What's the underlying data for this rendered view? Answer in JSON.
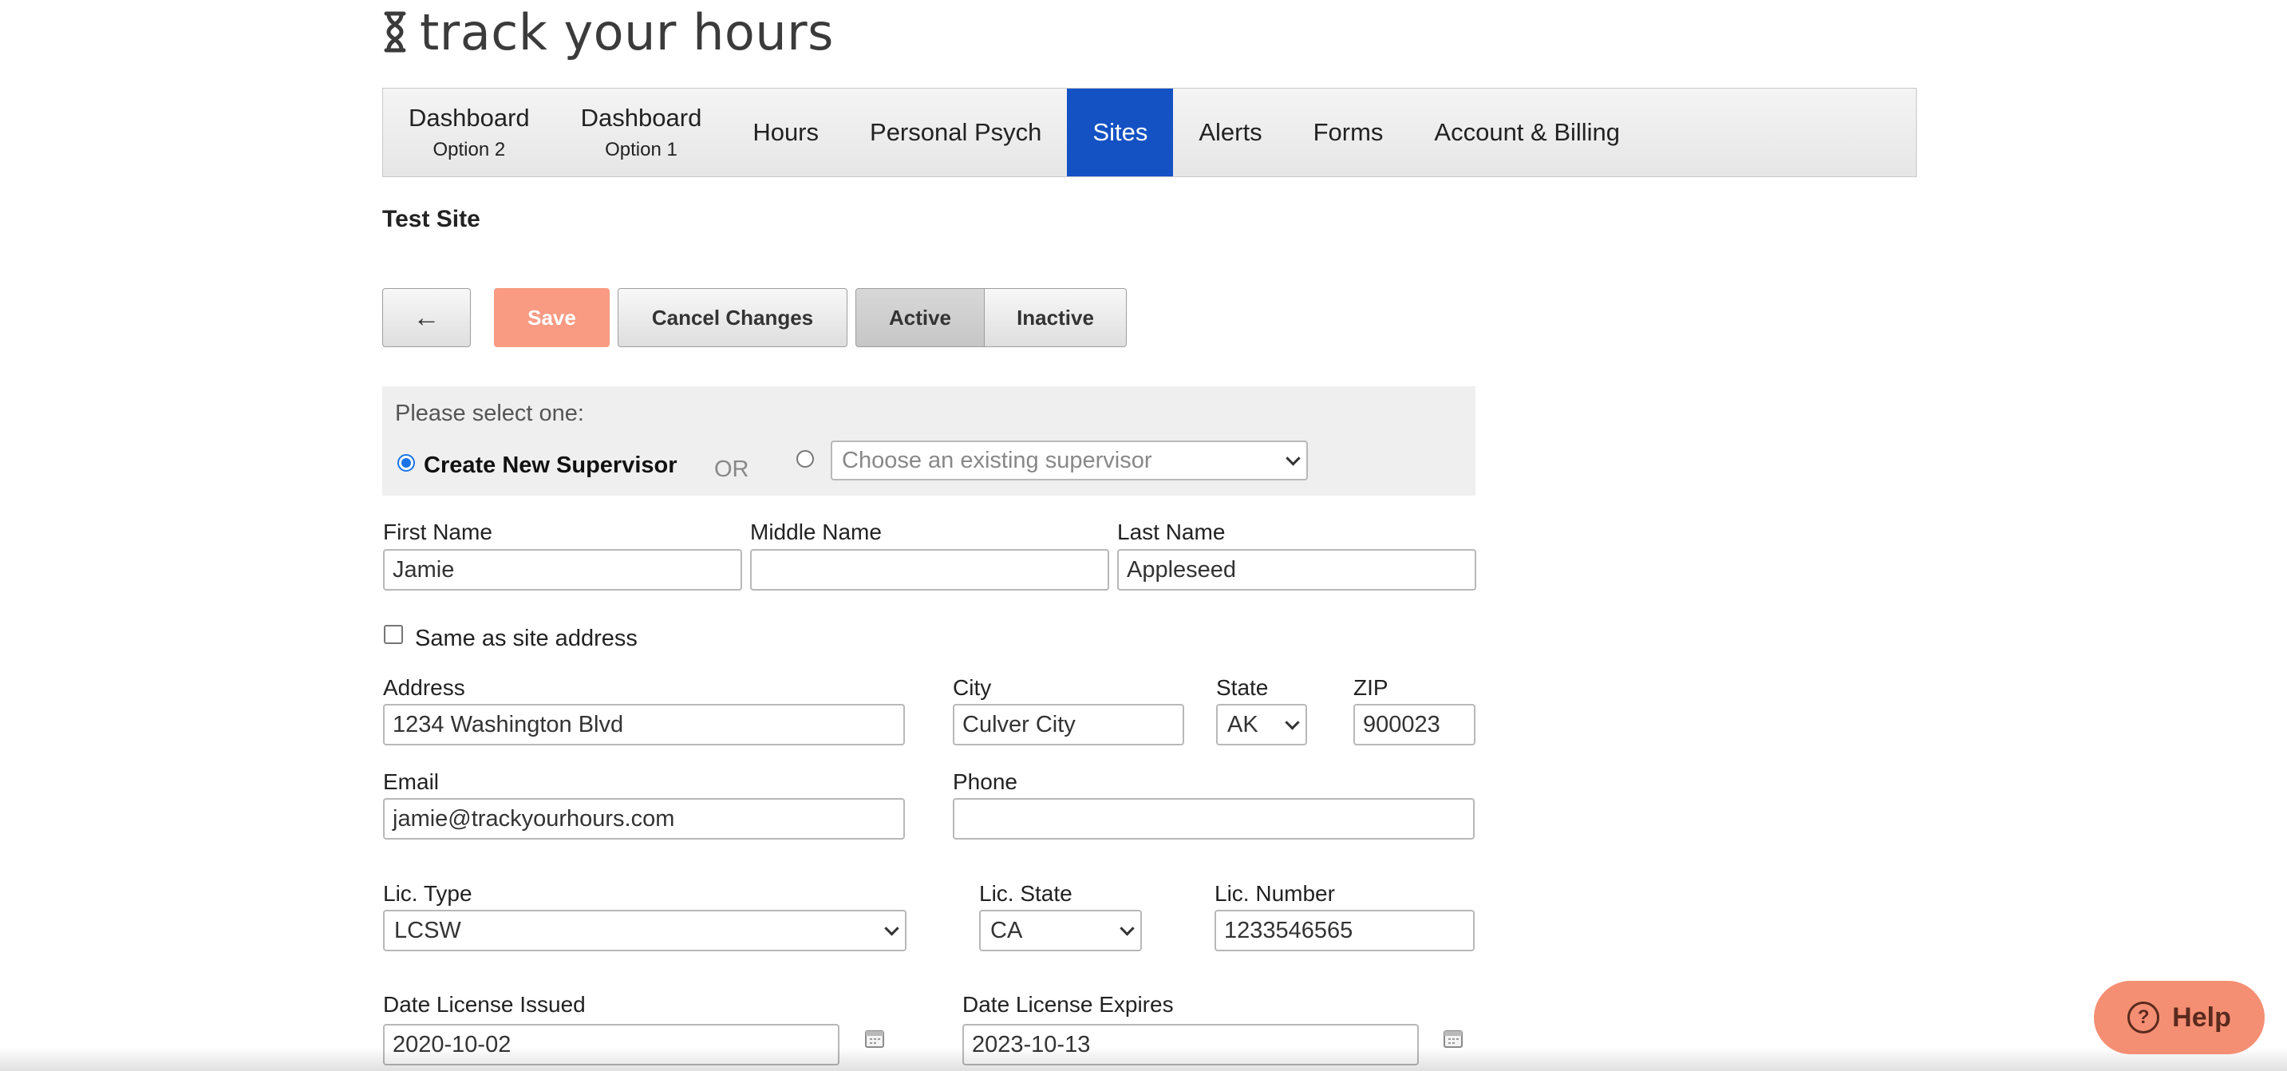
{
  "brand": {
    "name": "track your hours",
    "icon": "hourglass-icon"
  },
  "nav": {
    "items": [
      {
        "label": "Dashboard",
        "sub": "Option 2"
      },
      {
        "label": "Dashboard",
        "sub": "Option 1"
      },
      {
        "label": "Hours"
      },
      {
        "label": "Personal Psych"
      },
      {
        "label": "Sites",
        "active": true
      },
      {
        "label": "Alerts"
      },
      {
        "label": "Forms"
      },
      {
        "label": "Account & Billing"
      }
    ],
    "active_color": "#1452c4"
  },
  "page": {
    "title": "Test Site"
  },
  "toolbar": {
    "back_label": "←",
    "save_label": "Save",
    "cancel_label": "Cancel Changes",
    "active_label": "Active",
    "inactive_label": "Inactive",
    "save_color": "#f99a82"
  },
  "supervisor_select": {
    "prompt": "Please select one:",
    "create_label": "Create New Supervisor",
    "or_label": "OR",
    "existing_placeholder": "Choose an existing supervisor",
    "create_selected": true
  },
  "form": {
    "first_name": {
      "label": "First Name",
      "value": "Jamie"
    },
    "middle_name": {
      "label": "Middle Name",
      "value": ""
    },
    "last_name": {
      "label": "Last Name",
      "value": "Appleseed"
    },
    "same_address": {
      "label": "Same as site address",
      "checked": false
    },
    "address": {
      "label": "Address",
      "value": "1234 Washington Blvd"
    },
    "city": {
      "label": "City",
      "value": "Culver City"
    },
    "state": {
      "label": "State",
      "value": "AK"
    },
    "zip": {
      "label": "ZIP",
      "value": "900023"
    },
    "email": {
      "label": "Email",
      "value": "jamie@trackyourhours.com"
    },
    "phone": {
      "label": "Phone",
      "value": ""
    },
    "lic_type": {
      "label": "Lic. Type",
      "value": "LCSW"
    },
    "lic_state": {
      "label": "Lic. State",
      "value": "CA"
    },
    "lic_number": {
      "label": "Lic. Number",
      "value": "1233546565"
    },
    "date_issued": {
      "label": "Date License Issued",
      "value": "2020-10-02"
    },
    "date_expires": {
      "label": "Date License Expires",
      "value": "2023-10-13"
    }
  },
  "help": {
    "label": "Help",
    "icon": "question-circle-icon",
    "color": "#f58f73"
  }
}
